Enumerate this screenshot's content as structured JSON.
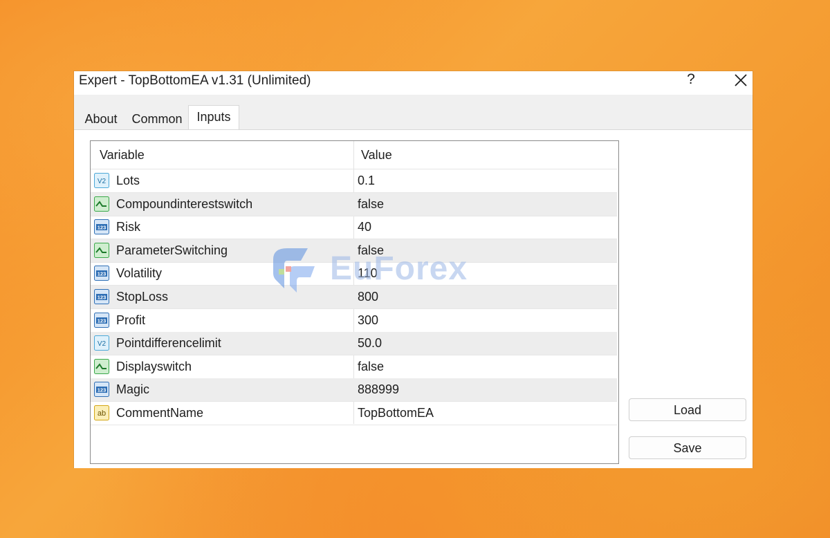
{
  "window": {
    "title": "Expert - TopBottomEA v1.31 (Unlimited)",
    "help_label": "?",
    "close_icon": "close-icon"
  },
  "tabs": [
    {
      "label": "About",
      "active": false
    },
    {
      "label": "Common",
      "active": false
    },
    {
      "label": "Inputs",
      "active": true
    }
  ],
  "grid": {
    "columns": {
      "variable": "Variable",
      "value": "Value"
    },
    "rows": [
      {
        "icon": "double-value-icon",
        "name": "Lots",
        "value": "0.1"
      },
      {
        "icon": "bool-icon",
        "name": "Compoundinterestswitch",
        "value": "false"
      },
      {
        "icon": "int-icon",
        "name": "Risk",
        "value": "40"
      },
      {
        "icon": "bool-icon",
        "name": "ParameterSwitching",
        "value": "false"
      },
      {
        "icon": "int-icon",
        "name": "Volatility",
        "value": "110"
      },
      {
        "icon": "int-icon",
        "name": "StopLoss",
        "value": "800"
      },
      {
        "icon": "int-icon",
        "name": "Profit",
        "value": "300"
      },
      {
        "icon": "double-value-icon",
        "name": "Pointdifferencelimit",
        "value": "50.0"
      },
      {
        "icon": "bool-icon",
        "name": "Displayswitch",
        "value": "false"
      },
      {
        "icon": "int-icon",
        "name": "Magic",
        "value": "888999"
      },
      {
        "icon": "string-icon",
        "name": "CommentName",
        "value": "TopBottomEA"
      }
    ]
  },
  "buttons": {
    "load": "Load",
    "save": "Save"
  },
  "watermark": {
    "text": "EuForex"
  },
  "colors": {
    "background": "#f5861f",
    "dialog": "#f0f0f0",
    "double_icon": "#4ba8d8",
    "bool_icon": "#3aa84a",
    "int_icon": "#2f6fb5",
    "string_icon": "#e6b820"
  }
}
